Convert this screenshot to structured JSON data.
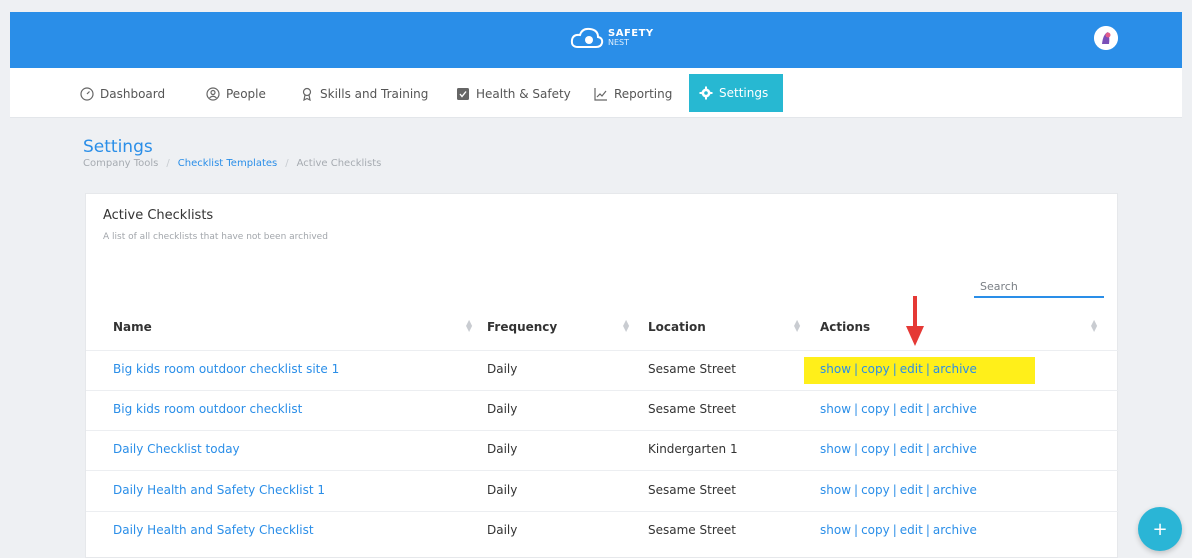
{
  "header": {
    "logo_line1": "SAFETY",
    "logo_line2": "NEST",
    "brand_color": "#2a8ee8"
  },
  "nav": {
    "items": [
      {
        "label": "Dashboard",
        "icon": "dashboard-icon"
      },
      {
        "label": "People",
        "icon": "person-icon"
      },
      {
        "label": "Skills and Training",
        "icon": "award-icon"
      },
      {
        "label": "Health & Safety",
        "icon": "checkbox-icon"
      },
      {
        "label": "Reporting",
        "icon": "chart-icon"
      },
      {
        "label": "Settings",
        "icon": "gear-icon",
        "active": true
      }
    ]
  },
  "page": {
    "title": "Settings",
    "breadcrumb": [
      "Company Tools",
      "Checklist Templates",
      "Active Checklists"
    ]
  },
  "card": {
    "title": "Active Checklists",
    "subtitle": "A list of all checklists that have not been archived",
    "search_placeholder": "Search"
  },
  "table": {
    "columns": [
      "Name",
      "Frequency",
      "Location",
      "Actions"
    ],
    "actions": [
      "show",
      "copy",
      "edit",
      "archive"
    ],
    "rows": [
      {
        "name": "Big kids room outdoor checklist site 1",
        "frequency": "Daily",
        "location": "Sesame Street"
      },
      {
        "name": "Big kids room outdoor checklist",
        "frequency": "Daily",
        "location": "Sesame Street"
      },
      {
        "name": "Daily Checklist today",
        "frequency": "Daily",
        "location": "Kindergarten 1"
      },
      {
        "name": "Daily Health and Safety Checklist 1",
        "frequency": "Daily",
        "location": "Sesame Street"
      },
      {
        "name": "Daily Health and Safety Checklist",
        "frequency": "Daily",
        "location": "Sesame Street"
      }
    ]
  },
  "fab": {
    "label": "+"
  },
  "colors": {
    "accent": "#27b8d2",
    "highlight": "#ffef1a",
    "arrow": "#e53935"
  }
}
